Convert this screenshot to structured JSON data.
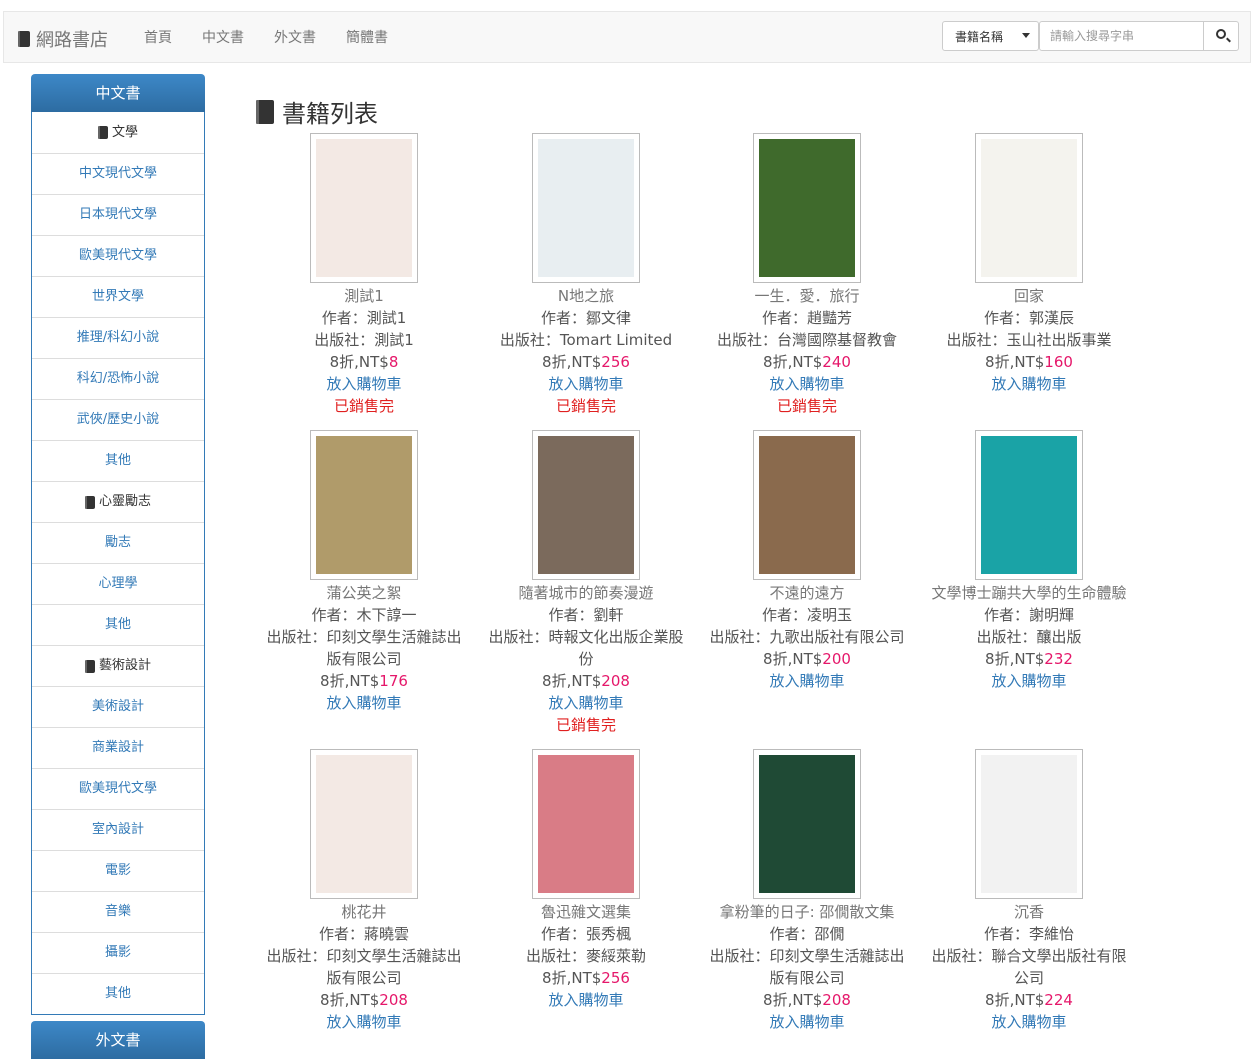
{
  "brand": "網路書店",
  "nav": [
    "首頁",
    "中文書",
    "外文書",
    "簡體書"
  ],
  "search": {
    "select": "書籍名稱",
    "placeholder": "請輸入搜尋字串"
  },
  "sidebar": {
    "head": "中文書",
    "items": [
      {
        "label": "文學",
        "cat": true
      },
      {
        "label": "中文現代文學"
      },
      {
        "label": "日本現代文學"
      },
      {
        "label": "歐美現代文學"
      },
      {
        "label": "世界文學"
      },
      {
        "label": "推理/科幻小說"
      },
      {
        "label": "科幻/恐怖小說"
      },
      {
        "label": "武俠/歷史小說"
      },
      {
        "label": "其他"
      },
      {
        "label": "心靈勵志",
        "cat": true
      },
      {
        "label": "勵志"
      },
      {
        "label": "心理學"
      },
      {
        "label": "其他"
      },
      {
        "label": "藝術設計",
        "cat": true
      },
      {
        "label": "美術設計"
      },
      {
        "label": "商業設計"
      },
      {
        "label": "歐美現代文學"
      },
      {
        "label": "室內設計"
      },
      {
        "label": "電影"
      },
      {
        "label": "音樂"
      },
      {
        "label": "攝影"
      },
      {
        "label": "其他"
      }
    ],
    "foot": "外文書"
  },
  "page_title": "書籍列表",
  "labels": {
    "author": "作者：",
    "publisher": "出版社：",
    "discount": "8折,NT$",
    "cart": "放入購物車",
    "sold": "已銷售完"
  },
  "books": [
    {
      "title": "測試1",
      "author": "測試1",
      "pub": "測試1",
      "price": "8",
      "sold": true,
      "cover": "#f3e9e4"
    },
    {
      "title": "N地之旅",
      "author": "鄒文律",
      "pub": "Tomart Limited",
      "price": "256",
      "sold": true,
      "cover": "#e8eef1"
    },
    {
      "title": "一生．愛．旅行",
      "author": "趙豔芳",
      "pub": "台灣國際基督教會",
      "price": "240",
      "sold": true,
      "cover": "#3f6a2c"
    },
    {
      "title": "回家",
      "author": "郭漢辰",
      "pub": "玉山社出版事業",
      "price": "160",
      "sold": false,
      "cover": "#f4f3ee"
    },
    {
      "title": "蒲公英之絮",
      "author": "木下諄一",
      "pub": "印刻文學生活雜誌出版有限公司",
      "price": "176",
      "sold": false,
      "cover": "#b09b6a"
    },
    {
      "title": "隨著城市的節奏漫遊",
      "author": "劉軒",
      "pub": "時報文化出版企業股份",
      "price": "208",
      "sold": true,
      "cover": "#7b6a5c"
    },
    {
      "title": "不遠的遠方",
      "author": "凌明玉",
      "pub": "九歌出版社有限公司",
      "price": "200",
      "sold": false,
      "cover": "#8a6a4d"
    },
    {
      "title": "文學博士蹦共大學的生命體驗",
      "author": "謝明輝",
      "pub": "釀出版",
      "price": "232",
      "sold": false,
      "cover": "#1aa3a6"
    },
    {
      "title": "桃花井",
      "author": "蔣曉雲",
      "pub": "印刻文學生活雜誌出版有限公司",
      "price": "208",
      "sold": false,
      "cover": "#f3e9e4"
    },
    {
      "title": "魯迅雜文選集",
      "author": "張秀楓",
      "pub": "麥綏萊勒",
      "price": "256",
      "sold": false,
      "cover": "#d97c86"
    },
    {
      "title": "拿粉筆的日子: 邵僩散文集",
      "author": "邵僩",
      "pub": "印刻文學生活雜誌出版有限公司",
      "price": "208",
      "sold": false,
      "cover": "#1f4a35"
    },
    {
      "title": "沉香",
      "author": "李維怡",
      "pub": "聯合文學出版社有限公司",
      "price": "224",
      "sold": false,
      "cover": "#f2f2f2"
    }
  ]
}
